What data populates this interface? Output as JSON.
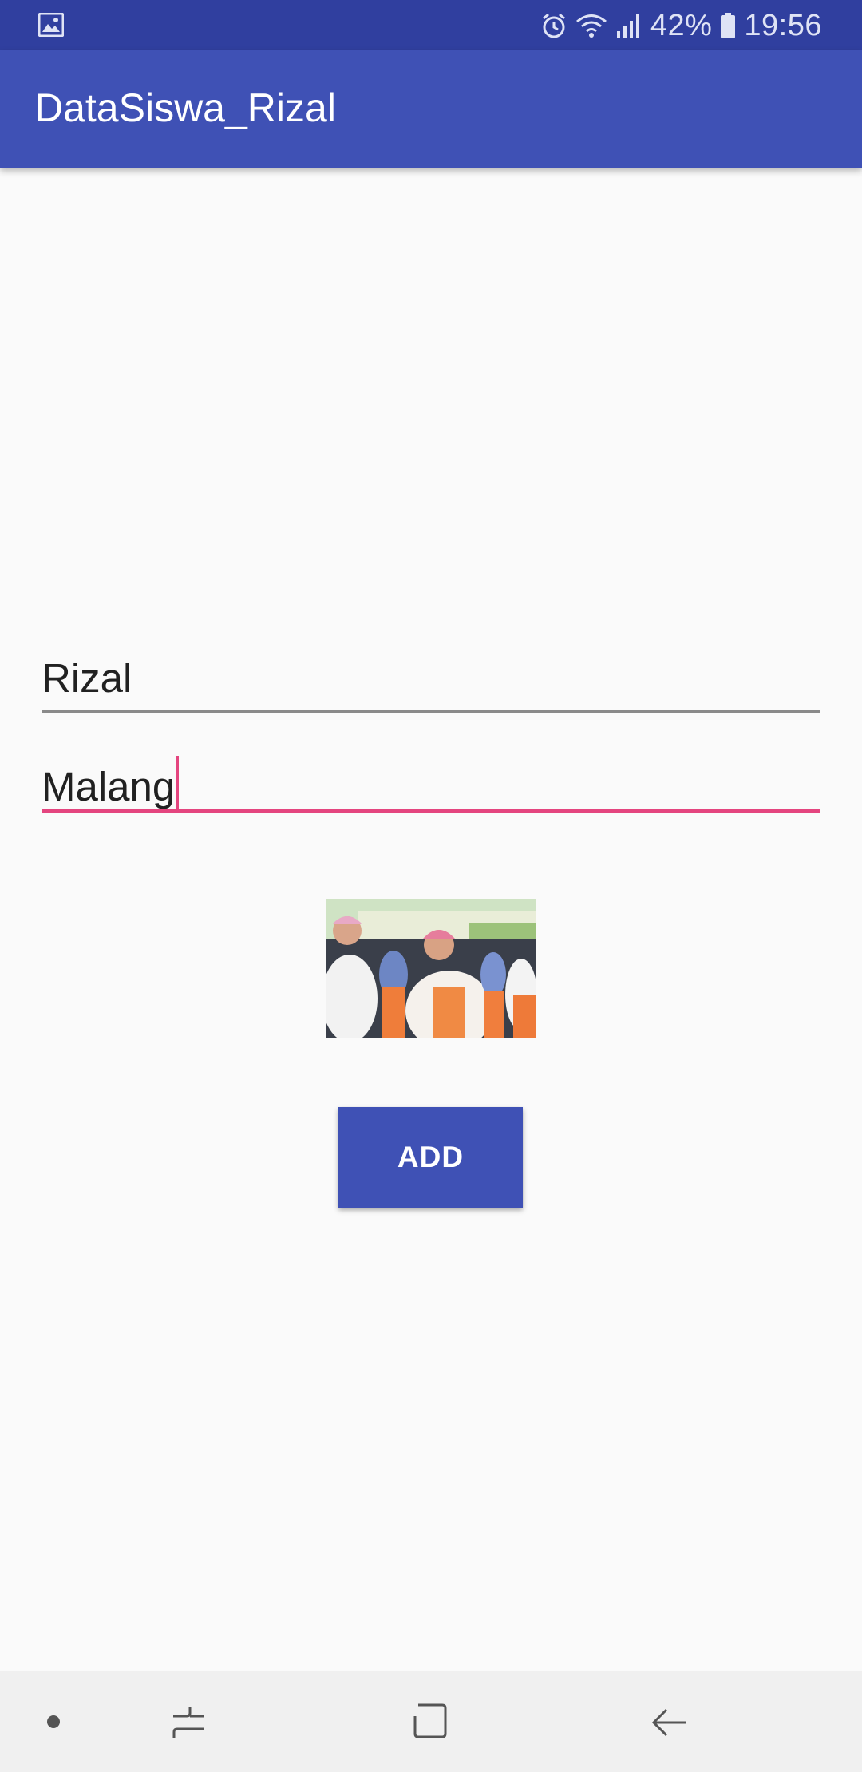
{
  "status_bar": {
    "notification_icon": "image-icon",
    "icons": [
      "alarm-icon",
      "wifi-icon",
      "signal-icon"
    ],
    "battery_percent": "42%",
    "battery_icon": "battery-icon",
    "time": "19:56"
  },
  "app_bar": {
    "title": "DataSiswa_Rizal",
    "color": "#3f51b5"
  },
  "form": {
    "name_field": {
      "value": "Rizal"
    },
    "city_field": {
      "value": "Malang",
      "focused": true,
      "accent_color": "#e4457f"
    },
    "photo": {
      "icon": "student-photo"
    },
    "add_button": {
      "label": "ADD"
    }
  },
  "nav_bar": {
    "items": [
      "dot-icon",
      "recent-apps-icon",
      "home-icon",
      "back-icon"
    ]
  }
}
